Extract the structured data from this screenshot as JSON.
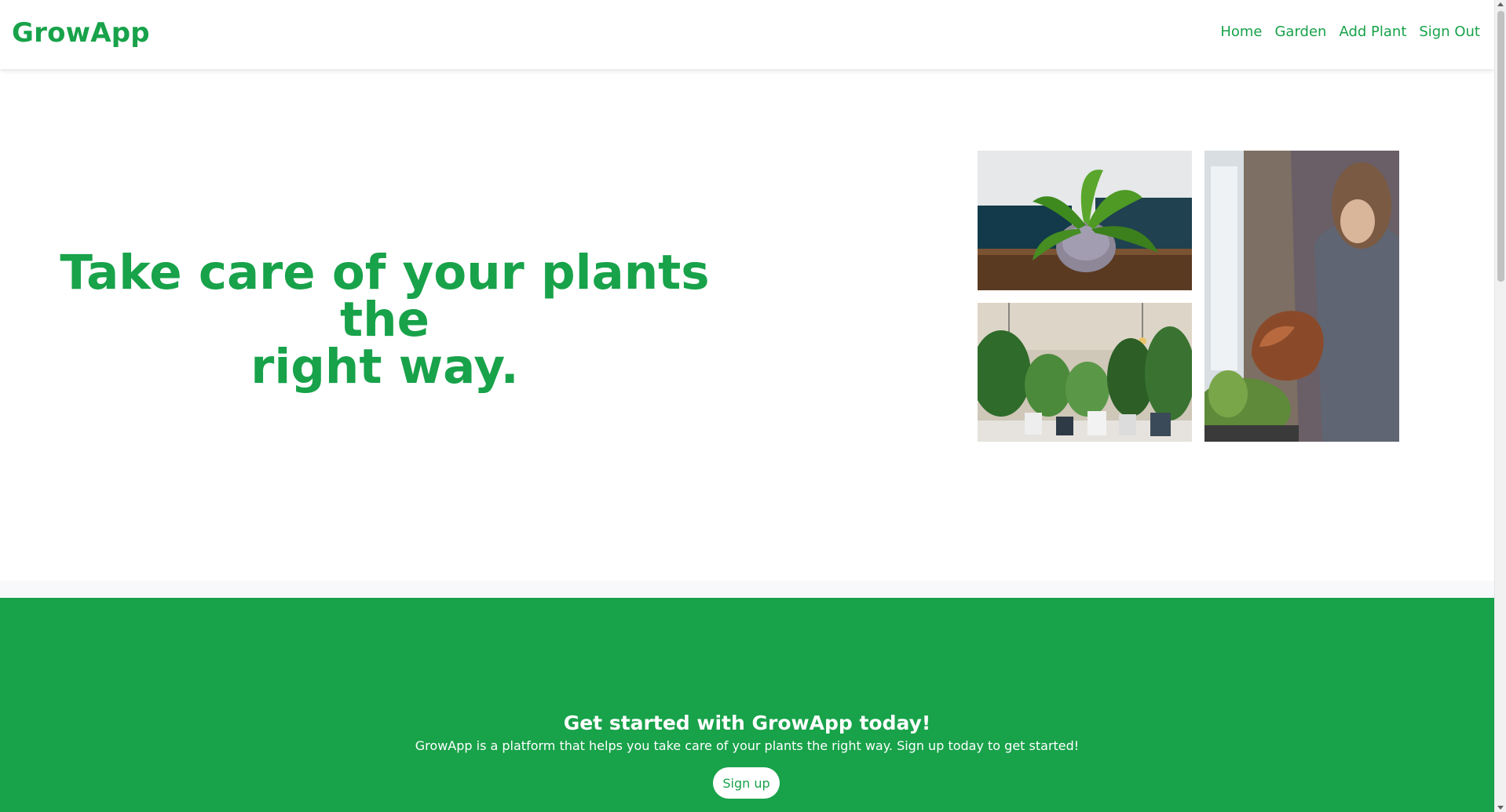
{
  "app": {
    "brand": "GrowApp"
  },
  "nav": {
    "items": [
      {
        "label": "Home"
      },
      {
        "label": "Garden"
      },
      {
        "label": "Add Plant"
      },
      {
        "label": "Sign Out"
      }
    ]
  },
  "hero": {
    "title_line1": "Take care of your plants the",
    "title_line2": "right way.",
    "photos": [
      "monstera-plant-photo",
      "plant-collection-photo",
      "watering-plant-photo"
    ]
  },
  "cta": {
    "title": "Get started with GrowApp today!",
    "text": "GrowApp is a platform that helps you take care of your plants the right way. Sign up today to get started!",
    "button_label": "Sign up"
  },
  "colors": {
    "brand_green": "#18a24a",
    "background": "#ffffff",
    "button_bg": "#ffffff"
  }
}
